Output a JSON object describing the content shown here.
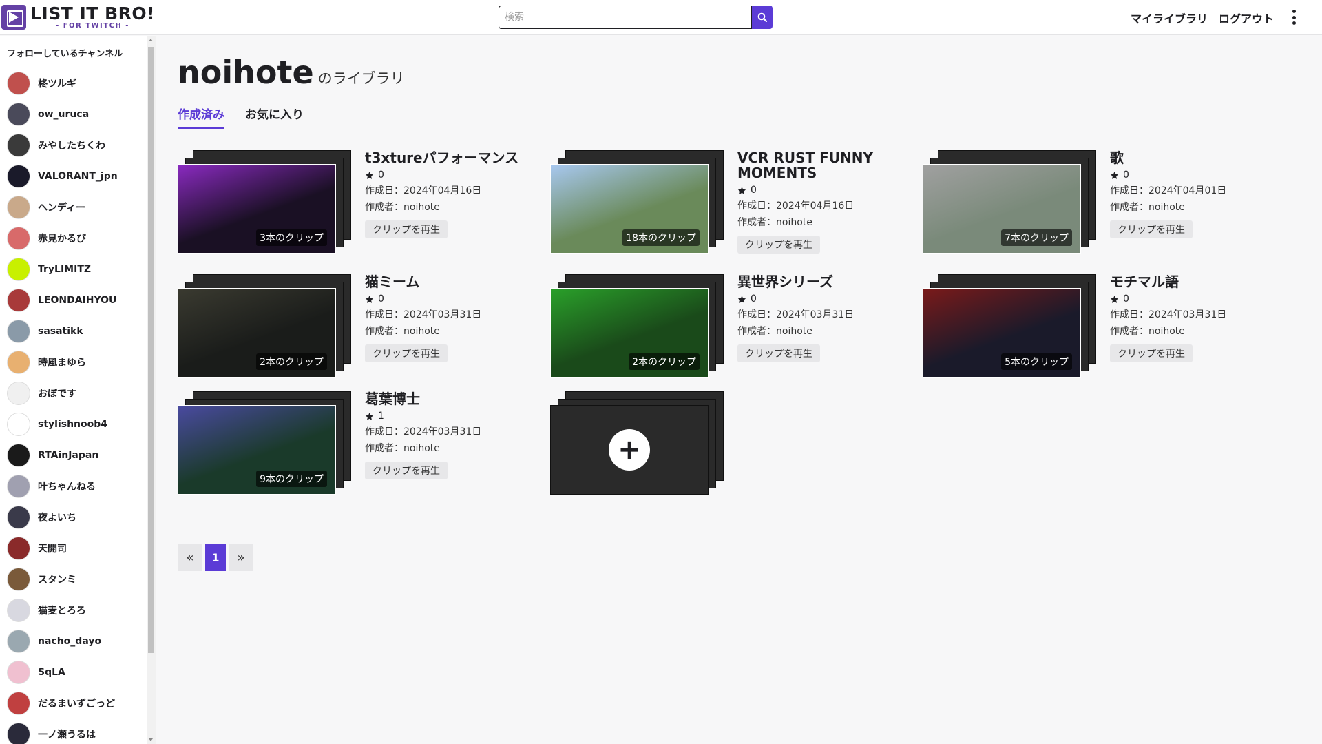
{
  "header": {
    "logo_main": "LIST IT BRO!",
    "logo_sub": "- FOR TWITCH -",
    "search_placeholder": "検索",
    "nav_library": "マイライブラリ",
    "nav_logout": "ログアウト"
  },
  "sidebar": {
    "title": "フォローしているチャンネル",
    "channels": [
      {
        "name": "柊ツルギ",
        "color": "#c0504d"
      },
      {
        "name": "ow_uruca",
        "color": "#4a4a5a"
      },
      {
        "name": "みやしたちくわ",
        "color": "#3a3a3a"
      },
      {
        "name": "VALORANT_jpn",
        "color": "#1a1a2a"
      },
      {
        "name": "ヘンディー",
        "color": "#c9a98a"
      },
      {
        "name": "赤見かるび",
        "color": "#d86a6a"
      },
      {
        "name": "TryLIMITZ",
        "color": "#c8f000"
      },
      {
        "name": "LEONDAIHYOU",
        "color": "#a83a3a"
      },
      {
        "name": "sasatikk",
        "color": "#8a9aa8"
      },
      {
        "name": "時風まゆら",
        "color": "#e8b070"
      },
      {
        "name": "おぼです",
        "color": "#f0f0f0"
      },
      {
        "name": "stylishnoob4",
        "color": "#ffffff"
      },
      {
        "name": "RTAinJapan",
        "color": "#1a1a1a"
      },
      {
        "name": "叶ちゃんねる",
        "color": "#a0a0b0"
      },
      {
        "name": "夜よいち",
        "color": "#3a3a4a"
      },
      {
        "name": "天開司",
        "color": "#8a2a2a"
      },
      {
        "name": "スタンミ",
        "color": "#7a5a3a"
      },
      {
        "name": "猫麦とろろ",
        "color": "#d8d8e0"
      },
      {
        "name": "nacho_dayo",
        "color": "#9aa8b0"
      },
      {
        "name": "SqLA",
        "color": "#f0c0d0"
      },
      {
        "name": "だるまいずごっど",
        "color": "#c04040"
      },
      {
        "name": "一ノ瀬うるは",
        "color": "#2a2a3a"
      }
    ]
  },
  "main": {
    "username": "noihote",
    "title_suffix": "のライブラリ",
    "tabs": [
      "作成済み",
      "お気に入り"
    ],
    "play_label": "クリップを再生",
    "date_prefix": "作成日：",
    "author_prefix": "作成者：",
    "lists": [
      {
        "title": "t3xtureパフォーマンス",
        "stars": "0",
        "date": "2024年04月16日",
        "author": "noihote",
        "clips": "3本のクリップ",
        "thumb_color": "#1a1024",
        "accent": "#8a2ac0"
      },
      {
        "title": "VCR RUST FUNNY MOMENTS",
        "stars": "0",
        "date": "2024年04月16日",
        "author": "noihote",
        "clips": "18本のクリップ",
        "thumb_color": "#6a8a5a",
        "accent": "#a8c8f0"
      },
      {
        "title": "歌",
        "stars": "0",
        "date": "2024年04月01日",
        "author": "noihote",
        "clips": "7本のクリップ",
        "thumb_color": "#7a8a7a",
        "accent": "#a0a0a0"
      },
      {
        "title": "猫ミーム",
        "stars": "0",
        "date": "2024年03月31日",
        "author": "noihote",
        "clips": "2本のクリップ",
        "thumb_color": "#1a1c1a",
        "accent": "#3a3a30"
      },
      {
        "title": "異世界シリーズ",
        "stars": "0",
        "date": "2024年03月31日",
        "author": "noihote",
        "clips": "2本のクリップ",
        "thumb_color": "#1a4a1a",
        "accent": "#2aa02a"
      },
      {
        "title": "モチマル語",
        "stars": "0",
        "date": "2024年03月31日",
        "author": "noihote",
        "clips": "5本のクリップ",
        "thumb_color": "#1a1a2a",
        "accent": "#7a1a1a"
      },
      {
        "title": "葛葉博士",
        "stars": "1",
        "date": "2024年03月31日",
        "author": "noihote",
        "clips": "9本のクリップ",
        "thumb_color": "#1a3a2a",
        "accent": "#4a4aa0"
      }
    ]
  },
  "pagination": {
    "prev": "«",
    "current": "1",
    "next": "»"
  },
  "colors": {
    "accent": "#5b3bd6",
    "brand": "#6441a5"
  }
}
